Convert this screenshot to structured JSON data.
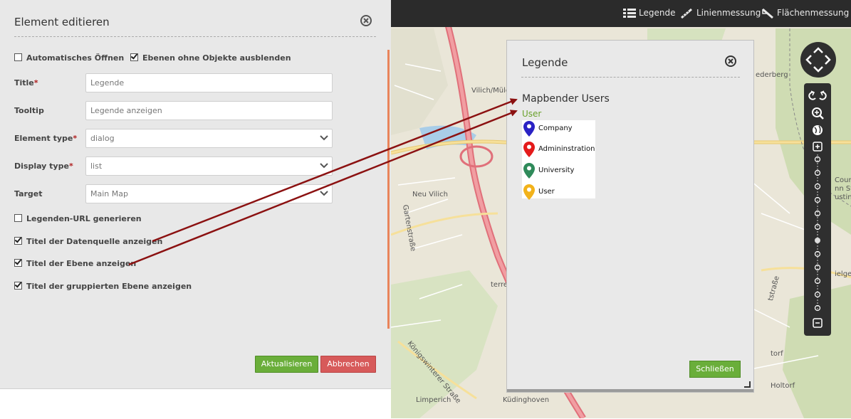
{
  "editor": {
    "title": "Element editieren",
    "checkbox_auto_open": {
      "label": "Automatisches Öffnen",
      "checked": false
    },
    "checkbox_hide_empty": {
      "label": "Ebenen ohne Objekte ausblenden",
      "checked": true
    },
    "fields": [
      {
        "label": "Title",
        "required": true,
        "value": "Legende",
        "type": "input"
      },
      {
        "label": "Tooltip",
        "required": false,
        "value": "Legende anzeigen",
        "type": "input"
      },
      {
        "label": "Element type",
        "required": true,
        "value": "dialog",
        "type": "select"
      },
      {
        "label": "Display type",
        "required": true,
        "value": "list",
        "type": "select"
      },
      {
        "label": "Target",
        "required": false,
        "value": "Main Map",
        "type": "select"
      }
    ],
    "required_marker": "*",
    "checkboxes": [
      {
        "label": "Legenden-URL generieren",
        "checked": false
      },
      {
        "label": "Titel der Datenquelle anzeigen",
        "checked": true
      },
      {
        "label": "Titel der Ebene anzeigen",
        "checked": true
      },
      {
        "label": "Titel der gruppierten Ebene anzeigen",
        "checked": true
      }
    ],
    "update_label": "Aktualisieren",
    "cancel_label": "Abbrechen"
  },
  "toolbar": {
    "items": [
      {
        "label": "Legende",
        "icon": "list-icon"
      },
      {
        "label": "Linienmessung",
        "icon": "ruler-line-icon"
      },
      {
        "label": "Flächenmessung",
        "icon": "ruler-area-icon"
      }
    ]
  },
  "legend": {
    "title": "Legende",
    "source_title": "Mapbender Users",
    "layer_title": "User",
    "items": [
      {
        "label": "Company",
        "color": "#2a22c4"
      },
      {
        "label": "Admininstration",
        "color": "#e41a1a"
      },
      {
        "label": "University",
        "color": "#2f8a5a"
      },
      {
        "label": "User",
        "color": "#f2b21a"
      }
    ],
    "close_label": "Schließen"
  },
  "map_labels": [
    {
      "text": "Vilich/Müldorf"
    },
    {
      "text": "Neu Vilich"
    },
    {
      "text": "Gartenstraße"
    },
    {
      "text": "Königswinterer Straße"
    },
    {
      "text": "Limperich"
    },
    {
      "text": "Küdinghoven"
    },
    {
      "text": "Holtorf"
    },
    {
      "text": "torf"
    },
    {
      "text": "terre"
    },
    {
      "text": "ederberg"
    },
    {
      "text": "Course"
    },
    {
      "text": "nn St."
    },
    {
      "text": "ustin"
    },
    {
      "text": "ielge"
    },
    {
      "text": "tstraße"
    }
  ],
  "colors": {
    "accent_green": "#6aae3a",
    "cancel_red": "#d75a5a",
    "annotation_arrow": "#8b1111",
    "required_red": "#b02020"
  }
}
